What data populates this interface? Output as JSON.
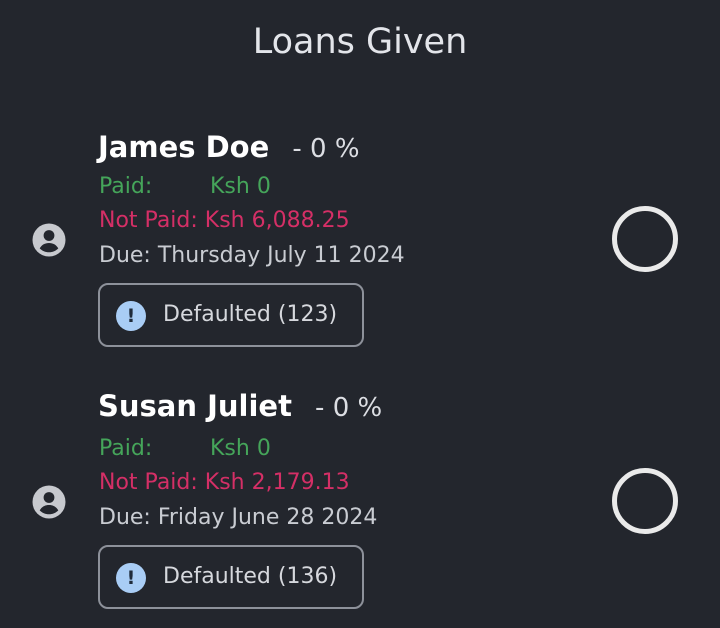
{
  "header": {
    "title": "Loans Given"
  },
  "loans": [
    {
      "name": "James Doe",
      "percent": "- 0 %",
      "paid_label": "Paid:",
      "paid_amount": "Ksh 0",
      "not_paid": "Not Paid: Ksh 6,088.25",
      "due": "Due: Thursday July 11 2024",
      "status": "Defaulted (123)",
      "status_icon": "exclamation-icon",
      "avatar_icon": "person-icon",
      "selected": false
    },
    {
      "name": "Susan Juliet",
      "percent": "- 0 %",
      "paid_label": "Paid:",
      "paid_amount": "Ksh 0",
      "not_paid": "Not Paid: Ksh 2,179.13",
      "due": "Due: Friday June 28 2024",
      "status": "Defaulted (136)",
      "status_icon": "exclamation-icon",
      "avatar_icon": "person-icon",
      "selected": false
    }
  ],
  "colors": {
    "background": "#23262d",
    "paid": "#45a55a",
    "not_paid": "#d42f66",
    "chip_icon": "#a9cdf5"
  }
}
